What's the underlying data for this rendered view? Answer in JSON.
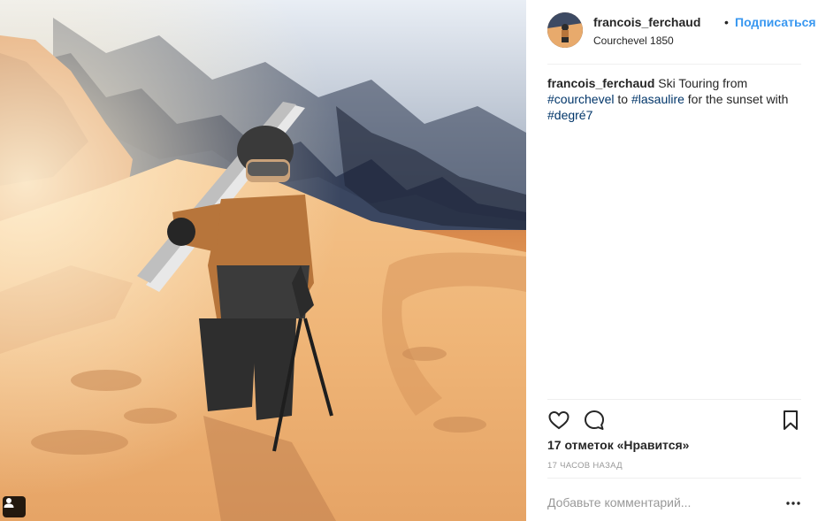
{
  "post": {
    "username": "francois_ferchaud",
    "follow_label": "Подписаться",
    "separator": "•",
    "location": "Courchevel 1850",
    "caption": {
      "username": "francois_ferchaud",
      "text_1": "Ski Touring from",
      "tag_1": "#courchevel",
      "text_2": "to",
      "tag_2": "#lasaulire",
      "text_3": "for the sunset with",
      "tag_3": "#degré7"
    },
    "likes": "17 отметок «Нравится»",
    "time": "17 часов назад",
    "comment_placeholder": "Добавьте комментарий..."
  },
  "icons": {
    "heart": "heart-icon",
    "comment": "comment-icon",
    "save": "bookmark-icon",
    "more": "more-options-icon",
    "user_tag": "user-tag-icon"
  },
  "colors": {
    "link_blue": "#3897f0",
    "hashtag": "#003569",
    "muted": "#999999",
    "divider": "#efefef"
  }
}
